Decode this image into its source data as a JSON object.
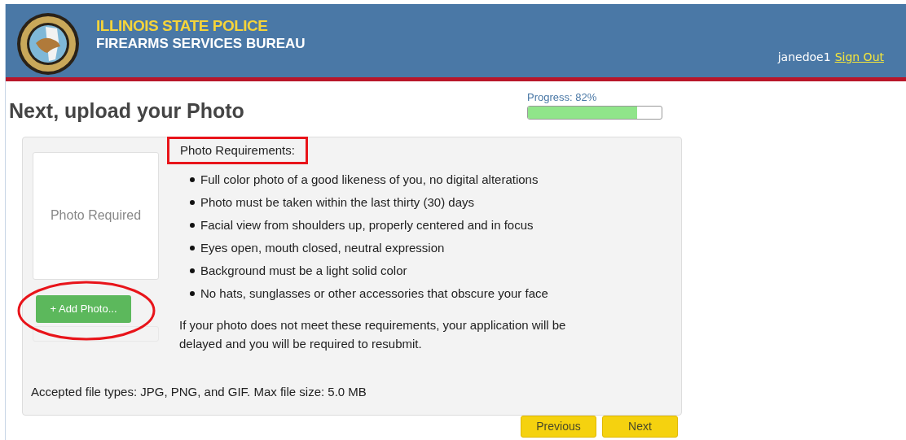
{
  "header": {
    "title": "ILLINOIS STATE POLICE",
    "subtitle": "FIREARMS SERVICES BUREAU",
    "username": "janedoe1",
    "sign_out": "Sign Out"
  },
  "page_title": "Next, upload your Photo",
  "progress": {
    "label": "Progress: 82%",
    "level": 0.82
  },
  "photo": {
    "empty_label": "Photo Required",
    "add_button": "+ Add Photo...",
    "highlighted": true
  },
  "requirements": {
    "heading": "Photo Requirements:",
    "highlighted": true,
    "items": [
      "Full color photo of a good likeness of you, no digital alterations",
      "Photo must be taken within the last thirty (30) days",
      "Facial view from shoulders up, properly centered and in focus",
      "Eyes open, mouth closed, neutral expression",
      "Background must be a light solid color",
      "No hats, sunglasses or other accessories that obscure your face"
    ],
    "note": "If your photo does not meet these requirements, your application will be delayed and you will be required to resubmit."
  },
  "accepted_types": "Accepted file types: JPG, PNG, and GIF. Max file size: 5.0 MB",
  "buttons": [
    "Previous",
    "Next"
  ]
}
